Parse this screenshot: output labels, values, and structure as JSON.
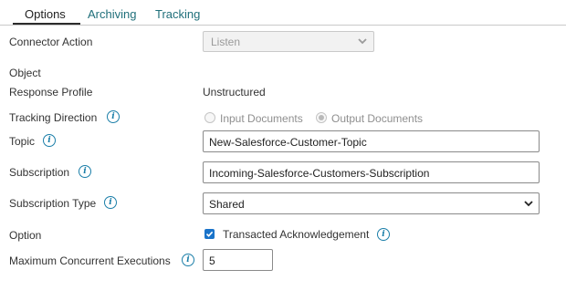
{
  "tabs": [
    {
      "label": "Options"
    },
    {
      "label": "Archiving"
    },
    {
      "label": "Tracking"
    }
  ],
  "form": {
    "connector_action": {
      "label": "Connector Action",
      "value": "Listen"
    },
    "object": {
      "label": "Object"
    },
    "response_profile": {
      "label": "Response Profile",
      "value": "Unstructured"
    },
    "tracking_direction": {
      "label": "Tracking Direction",
      "options": [
        "Input Documents",
        "Output Documents"
      ],
      "selected": "Output Documents"
    },
    "topic": {
      "label": "Topic",
      "value": "New-Salesforce-Customer-Topic"
    },
    "subscription": {
      "label": "Subscription",
      "value": "Incoming-Salesforce-Customers-Subscription"
    },
    "subscription_type": {
      "label": "Subscription Type",
      "value": "Shared"
    },
    "option": {
      "label": "Option",
      "checkbox_label": "Transacted Acknowledgement",
      "checked": true
    },
    "max_concurrent": {
      "label": "Maximum Concurrent Executions",
      "value": "5"
    }
  },
  "icons": {
    "info": "info-icon",
    "chevron": "chevron-down-icon"
  },
  "colors": {
    "accent": "#1a7ea8",
    "tab_link": "#1f6f7a",
    "checkbox": "#1a73c9"
  }
}
